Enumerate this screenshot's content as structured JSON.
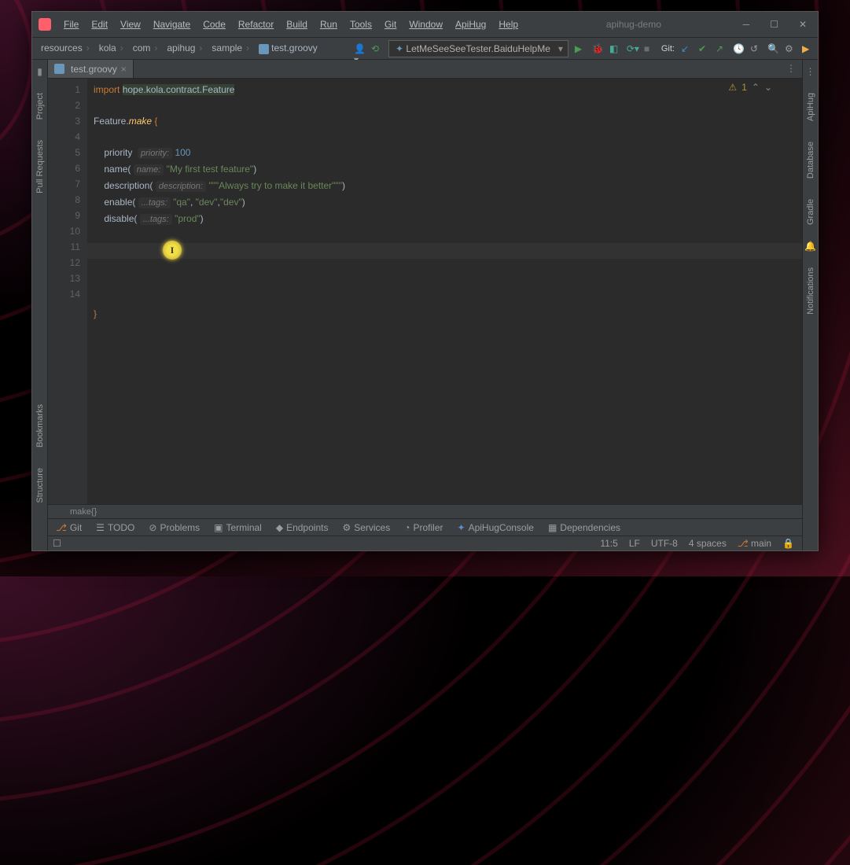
{
  "title": "apihug-demo",
  "menu": {
    "file": "File",
    "edit": "Edit",
    "view": "View",
    "navigate": "Navigate",
    "code": "Code",
    "refactor": "Refactor",
    "build": "Build",
    "run": "Run",
    "tools": "Tools",
    "git": "Git",
    "window": "Window",
    "apihug": "ApiHug",
    "help": "Help"
  },
  "breadcrumb": [
    "resources",
    "kola",
    "com",
    "apihug",
    "sample",
    "test.groovy"
  ],
  "runconfig": "LetMeSeeSeeTester.BaiduHelpMe",
  "gitLabel": "Git:",
  "tab": {
    "name": "test.groovy"
  },
  "warn": {
    "count": "1"
  },
  "code": {
    "l1_import": "import",
    "l1_pkg": "hope.kola.contract.Feature",
    "l3_feature": "Feature",
    "l3_make": "make",
    "l5_priority": "priority",
    "l5_hint": "priority:",
    "l5_val": "100",
    "l6_name": "name",
    "l6_hint": "name:",
    "l6_str": "\"My first test feature\"",
    "l7_desc": "description",
    "l7_hint": "description:",
    "l7_str": "\"\"\"Always try to make it better\"\"\"",
    "l8_enable": "enable",
    "l8_hint": "...tags:",
    "l8_a": "\"qa\"",
    "l8_b": "\"dev\"",
    "l8_c": "\"dev\"",
    "l9_disable": "disable",
    "l9_hint": "...tags:",
    "l9_a": "\"prod\""
  },
  "lines": [
    "1",
    "2",
    "3",
    "4",
    "5",
    "6",
    "7",
    "8",
    "9",
    "10",
    "11",
    "12",
    "13",
    "14"
  ],
  "crumbstrip": "make{}",
  "bottom": {
    "git": "Git",
    "todo": "TODO",
    "problems": "Problems",
    "terminal": "Terminal",
    "endpoints": "Endpoints",
    "services": "Services",
    "profiler": "Profiler",
    "apihug": "ApiHugConsole",
    "deps": "Dependencies"
  },
  "status": {
    "pos": "11:5",
    "le": "LF",
    "enc": "UTF-8",
    "indent": "4 spaces",
    "branch": "main"
  },
  "sidebarsL": {
    "project": "Project",
    "pull": "Pull Requests",
    "bookmarks": "Bookmarks",
    "structure": "Structure"
  },
  "sidebarsR": {
    "apihug": "ApiHug",
    "database": "Database",
    "gradle": "Gradle",
    "notifications": "Notifications"
  }
}
